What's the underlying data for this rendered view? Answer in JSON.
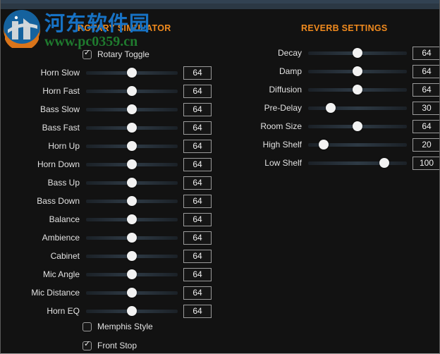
{
  "window": {
    "titlebar_color": "#2b3844",
    "background_color": "#121212",
    "accent_color": "#f08a1e"
  },
  "watermark": {
    "logo_icon": "globe-logo-icon",
    "site_name": "河东软件园",
    "site_url": "www.pc0359.cn",
    "site_name_color": "#1772c4",
    "site_url_color": "#1f7a2e"
  },
  "rotary_panel": {
    "title": "ROTARY SIMULATOR",
    "toggle": {
      "label": "Rotary Toggle",
      "checked": true
    },
    "sliders": [
      {
        "label": "Horn Slow",
        "value": "64",
        "percent": 50
      },
      {
        "label": "Horn Fast",
        "value": "64",
        "percent": 50
      },
      {
        "label": "Bass Slow",
        "value": "64",
        "percent": 50
      },
      {
        "label": "Bass Fast",
        "value": "64",
        "percent": 50
      },
      {
        "label": "Horn Up",
        "value": "64",
        "percent": 50
      },
      {
        "label": "Horn Down",
        "value": "64",
        "percent": 50
      },
      {
        "label": "Bass Up",
        "value": "64",
        "percent": 50
      },
      {
        "label": "Bass Down",
        "value": "64",
        "percent": 50
      },
      {
        "label": "Balance",
        "value": "64",
        "percent": 50
      },
      {
        "label": "Ambience",
        "value": "64",
        "percent": 50
      },
      {
        "label": "Cabinet",
        "value": "64",
        "percent": 50
      },
      {
        "label": "Mic Angle",
        "value": "64",
        "percent": 50
      },
      {
        "label": "Mic Distance",
        "value": "64",
        "percent": 50
      },
      {
        "label": "Horn EQ",
        "value": "64",
        "percent": 50
      }
    ],
    "checkboxes": [
      {
        "label": "Memphis Style",
        "checked": false
      },
      {
        "label": "Front Stop",
        "checked": true
      }
    ]
  },
  "reverb_panel": {
    "title": "REVERB SETTINGS",
    "sliders": [
      {
        "label": "Decay",
        "value": "64",
        "percent": 50
      },
      {
        "label": "Damp",
        "value": "64",
        "percent": 50
      },
      {
        "label": "Diffusion",
        "value": "64",
        "percent": 50
      },
      {
        "label": "Pre-Delay",
        "value": "30",
        "percent": 23
      },
      {
        "label": "Room Size",
        "value": "64",
        "percent": 50
      },
      {
        "label": "High Shelf",
        "value": "20",
        "percent": 16
      },
      {
        "label": "Low Shelf",
        "value": "100",
        "percent": 77
      }
    ]
  }
}
